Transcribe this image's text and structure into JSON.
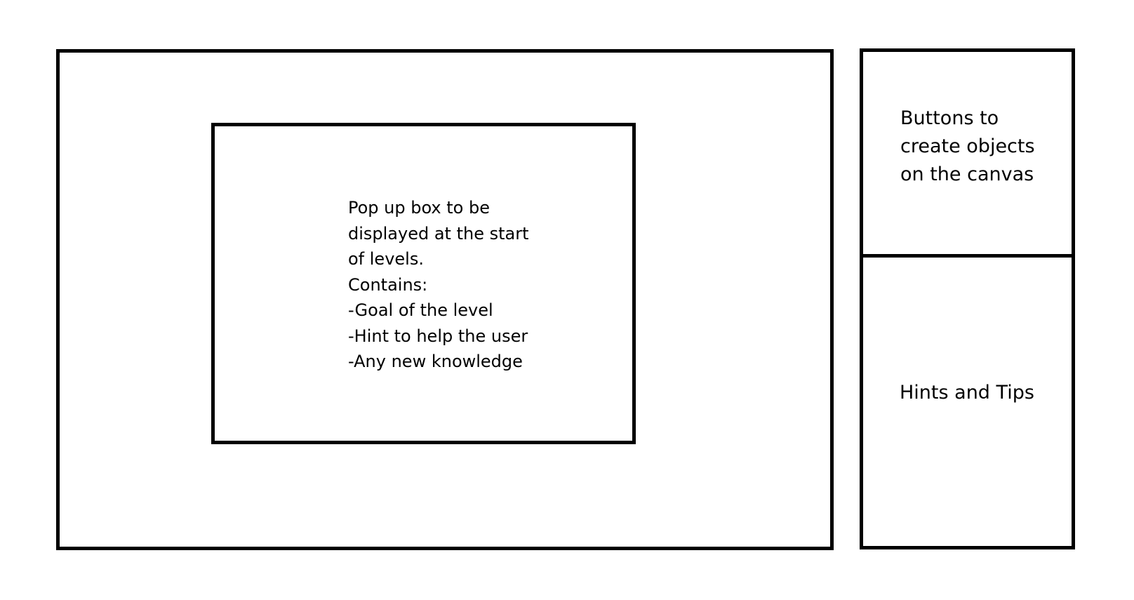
{
  "popup": {
    "lines": [
      "Pop up box to be",
      "displayed at the start",
      "of levels.",
      "Contains:",
      "-Goal of the level",
      "-Hint to help the user",
      "-Any new knowledge"
    ]
  },
  "side_panel": {
    "buttons_section": {
      "lines": [
        "Buttons to",
        "create objects",
        "on the canvas"
      ]
    },
    "hints_section": {
      "label": "Hints and Tips"
    }
  }
}
